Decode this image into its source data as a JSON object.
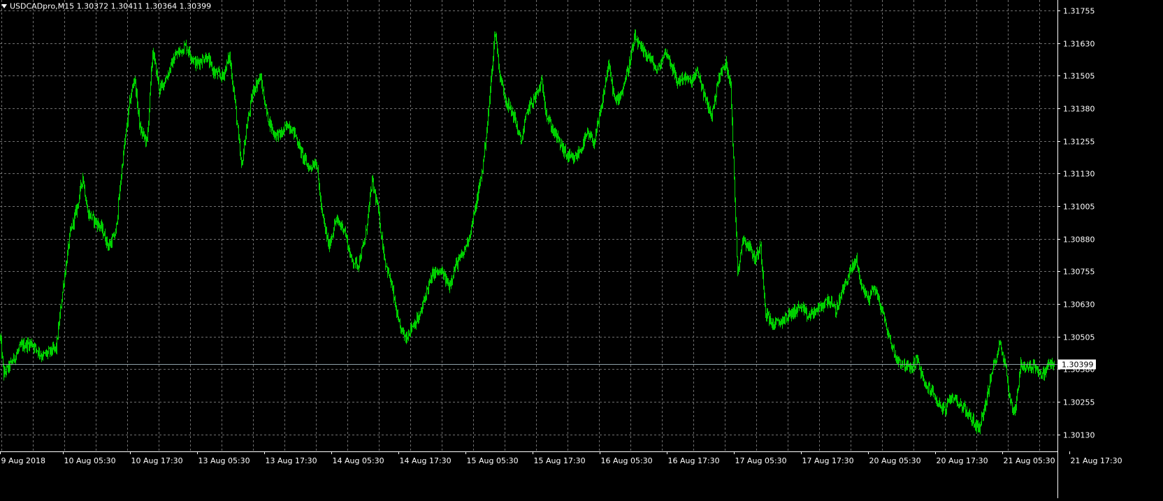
{
  "chart_data": {
    "type": "candlestick",
    "symbol": "USDCADpro",
    "timeframe": "M15",
    "ohlc_last": {
      "open": "1.30372",
      "high": "1.30411",
      "low": "1.30364",
      "close": "1.30399"
    },
    "header_text": "USDCADpro,M15  1.30372 1.30411 1.30364 1.30399",
    "current_price_label": "1.30399",
    "current_price": 1.30399,
    "ylim": [
      1.30065,
      1.31795
    ],
    "y_ticks": [
      {
        "value": 1.31755,
        "label": "1.31755"
      },
      {
        "value": 1.3163,
        "label": "1.31630"
      },
      {
        "value": 1.31505,
        "label": "1.31505"
      },
      {
        "value": 1.3138,
        "label": "1.31380"
      },
      {
        "value": 1.31255,
        "label": "1.31255"
      },
      {
        "value": 1.3113,
        "label": "1.31130"
      },
      {
        "value": 1.31005,
        "label": "1.31005"
      },
      {
        "value": 1.3088,
        "label": "1.30880"
      },
      {
        "value": 1.30755,
        "label": "1.30755"
      },
      {
        "value": 1.3063,
        "label": "1.30630"
      },
      {
        "value": 1.30505,
        "label": "1.30505"
      },
      {
        "value": 1.3038,
        "label": "1.30380"
      },
      {
        "value": 1.30255,
        "label": "1.30255"
      },
      {
        "value": 1.3013,
        "label": "1.30130"
      }
    ],
    "x_ticks": [
      {
        "index": 0,
        "label": "9 Aug 2018"
      },
      {
        "index": 96,
        "label": "10 Aug 05:30"
      },
      {
        "index": 192,
        "label": "10 Aug 17:30"
      },
      {
        "index": 288,
        "label": "13 Aug 05:30"
      },
      {
        "index": 384,
        "label": "13 Aug 17:30"
      },
      {
        "index": 480,
        "label": "14 Aug 05:30"
      },
      {
        "index": 576,
        "label": "14 Aug 17:30"
      },
      {
        "index": 672,
        "label": "15 Aug 05:30"
      },
      {
        "index": 768,
        "label": "15 Aug 17:30"
      },
      {
        "index": 864,
        "label": "16 Aug 05:30"
      },
      {
        "index": 960,
        "label": "16 Aug 17:30"
      },
      {
        "index": 1056,
        "label": "17 Aug 05:30"
      },
      {
        "index": 1152,
        "label": "17 Aug 17:30"
      },
      {
        "index": 1248,
        "label": "20 Aug 05:30"
      },
      {
        "index": 1344,
        "label": "20 Aug 17:30"
      },
      {
        "index": 1440,
        "label": "21 Aug 05:30"
      },
      {
        "index": 1536,
        "label": "21 Aug 17:30"
      }
    ],
    "bar_count": 1600,
    "price_path": [
      [
        0,
        1.305
      ],
      [
        5,
        1.3036
      ],
      [
        15,
        1.304
      ],
      [
        30,
        1.3047
      ],
      [
        45,
        1.3048
      ],
      [
        60,
        1.3043
      ],
      [
        80,
        1.3046
      ],
      [
        90,
        1.307
      ],
      [
        100,
        1.309
      ],
      [
        110,
        1.31
      ],
      [
        118,
        1.3112
      ],
      [
        125,
        1.3098
      ],
      [
        135,
        1.3095
      ],
      [
        145,
        1.3092
      ],
      [
        155,
        1.3085
      ],
      [
        165,
        1.309
      ],
      [
        175,
        1.3118
      ],
      [
        185,
        1.314
      ],
      [
        192,
        1.315
      ],
      [
        200,
        1.313
      ],
      [
        210,
        1.3125
      ],
      [
        218,
        1.316
      ],
      [
        228,
        1.3145
      ],
      [
        238,
        1.315
      ],
      [
        250,
        1.3158
      ],
      [
        265,
        1.3162
      ],
      [
        280,
        1.3155
      ],
      [
        295,
        1.3158
      ],
      [
        305,
        1.3152
      ],
      [
        318,
        1.315
      ],
      [
        328,
        1.3158
      ],
      [
        336,
        1.314
      ],
      [
        345,
        1.3115
      ],
      [
        352,
        1.313
      ],
      [
        362,
        1.3145
      ],
      [
        372,
        1.315
      ],
      [
        382,
        1.3135
      ],
      [
        392,
        1.3128
      ],
      [
        402,
        1.3128
      ],
      [
        412,
        1.3132
      ],
      [
        422,
        1.3128
      ],
      [
        432,
        1.312
      ],
      [
        442,
        1.3115
      ],
      [
        452,
        1.3118
      ],
      [
        460,
        1.3098
      ],
      [
        470,
        1.3085
      ],
      [
        480,
        1.3095
      ],
      [
        492,
        1.3092
      ],
      [
        502,
        1.308
      ],
      [
        512,
        1.3078
      ],
      [
        522,
        1.3088
      ],
      [
        532,
        1.311
      ],
      [
        540,
        1.31
      ],
      [
        550,
        1.308
      ],
      [
        560,
        1.307
      ],
      [
        570,
        1.3055
      ],
      [
        580,
        1.305
      ],
      [
        590,
        1.3055
      ],
      [
        600,
        1.3058
      ],
      [
        610,
        1.3068
      ],
      [
        620,
        1.3075
      ],
      [
        632,
        1.3075
      ],
      [
        642,
        1.307
      ],
      [
        652,
        1.3078
      ],
      [
        662,
        1.3082
      ],
      [
        672,
        1.309
      ],
      [
        680,
        1.31
      ],
      [
        690,
        1.3115
      ],
      [
        698,
        1.3135
      ],
      [
        704,
        1.3155
      ],
      [
        708,
        1.3168
      ],
      [
        715,
        1.315
      ],
      [
        725,
        1.314
      ],
      [
        735,
        1.3135
      ],
      [
        745,
        1.3125
      ],
      [
        755,
        1.3138
      ],
      [
        765,
        1.3142
      ],
      [
        775,
        1.3148
      ],
      [
        782,
        1.3135
      ],
      [
        790,
        1.313
      ],
      [
        800,
        1.3125
      ],
      [
        810,
        1.312
      ],
      [
        820,
        1.3118
      ],
      [
        830,
        1.3122
      ],
      [
        840,
        1.3128
      ],
      [
        850,
        1.3125
      ],
      [
        860,
        1.3138
      ],
      [
        870,
        1.3155
      ],
      [
        880,
        1.314
      ],
      [
        890,
        1.3145
      ],
      [
        900,
        1.3155
      ],
      [
        908,
        1.3165
      ],
      [
        918,
        1.316
      ],
      [
        928,
        1.3158
      ],
      [
        940,
        1.3152
      ],
      [
        952,
        1.316
      ],
      [
        960,
        1.3155
      ],
      [
        968,
        1.3148
      ],
      [
        978,
        1.315
      ],
      [
        988,
        1.3148
      ],
      [
        998,
        1.3152
      ],
      [
        1008,
        1.3142
      ],
      [
        1018,
        1.3135
      ],
      [
        1028,
        1.315
      ],
      [
        1038,
        1.3155
      ],
      [
        1045,
        1.3148
      ],
      [
        1050,
        1.311
      ],
      [
        1055,
        1.3075
      ],
      [
        1062,
        1.3088
      ],
      [
        1072,
        1.3085
      ],
      [
        1080,
        1.308
      ],
      [
        1088,
        1.3085
      ],
      [
        1095,
        1.306
      ],
      [
        1105,
        1.3055
      ],
      [
        1115,
        1.3056
      ],
      [
        1125,
        1.3058
      ],
      [
        1135,
        1.306
      ],
      [
        1145,
        1.3062
      ],
      [
        1155,
        1.3058
      ],
      [
        1165,
        1.306
      ],
      [
        1175,
        1.3062
      ],
      [
        1185,
        1.3065
      ],
      [
        1195,
        1.306
      ],
      [
        1205,
        1.3068
      ],
      [
        1215,
        1.3075
      ],
      [
        1225,
        1.308
      ],
      [
        1232,
        1.307
      ],
      [
        1242,
        1.3065
      ],
      [
        1250,
        1.307
      ],
      [
        1262,
        1.306
      ],
      [
        1272,
        1.305
      ],
      [
        1282,
        1.3042
      ],
      [
        1292,
        1.304
      ],
      [
        1302,
        1.3038
      ],
      [
        1312,
        1.3042
      ],
      [
        1322,
        1.3032
      ],
      [
        1332,
        1.303
      ],
      [
        1342,
        1.3025
      ],
      [
        1352,
        1.3022
      ],
      [
        1362,
        1.3028
      ],
      [
        1372,
        1.3025
      ],
      [
        1382,
        1.3022
      ],
      [
        1392,
        1.3018
      ],
      [
        1400,
        1.3015
      ],
      [
        1410,
        1.3025
      ],
      [
        1420,
        1.3038
      ],
      [
        1430,
        1.3048
      ],
      [
        1438,
        1.304
      ],
      [
        1445,
        1.3025
      ],
      [
        1452,
        1.3022
      ],
      [
        1460,
        1.304
      ],
      [
        1470,
        1.3038
      ],
      [
        1480,
        1.304
      ],
      [
        1490,
        1.3035
      ],
      [
        1500,
        1.304
      ],
      [
        1508,
        1.304
      ]
    ]
  }
}
